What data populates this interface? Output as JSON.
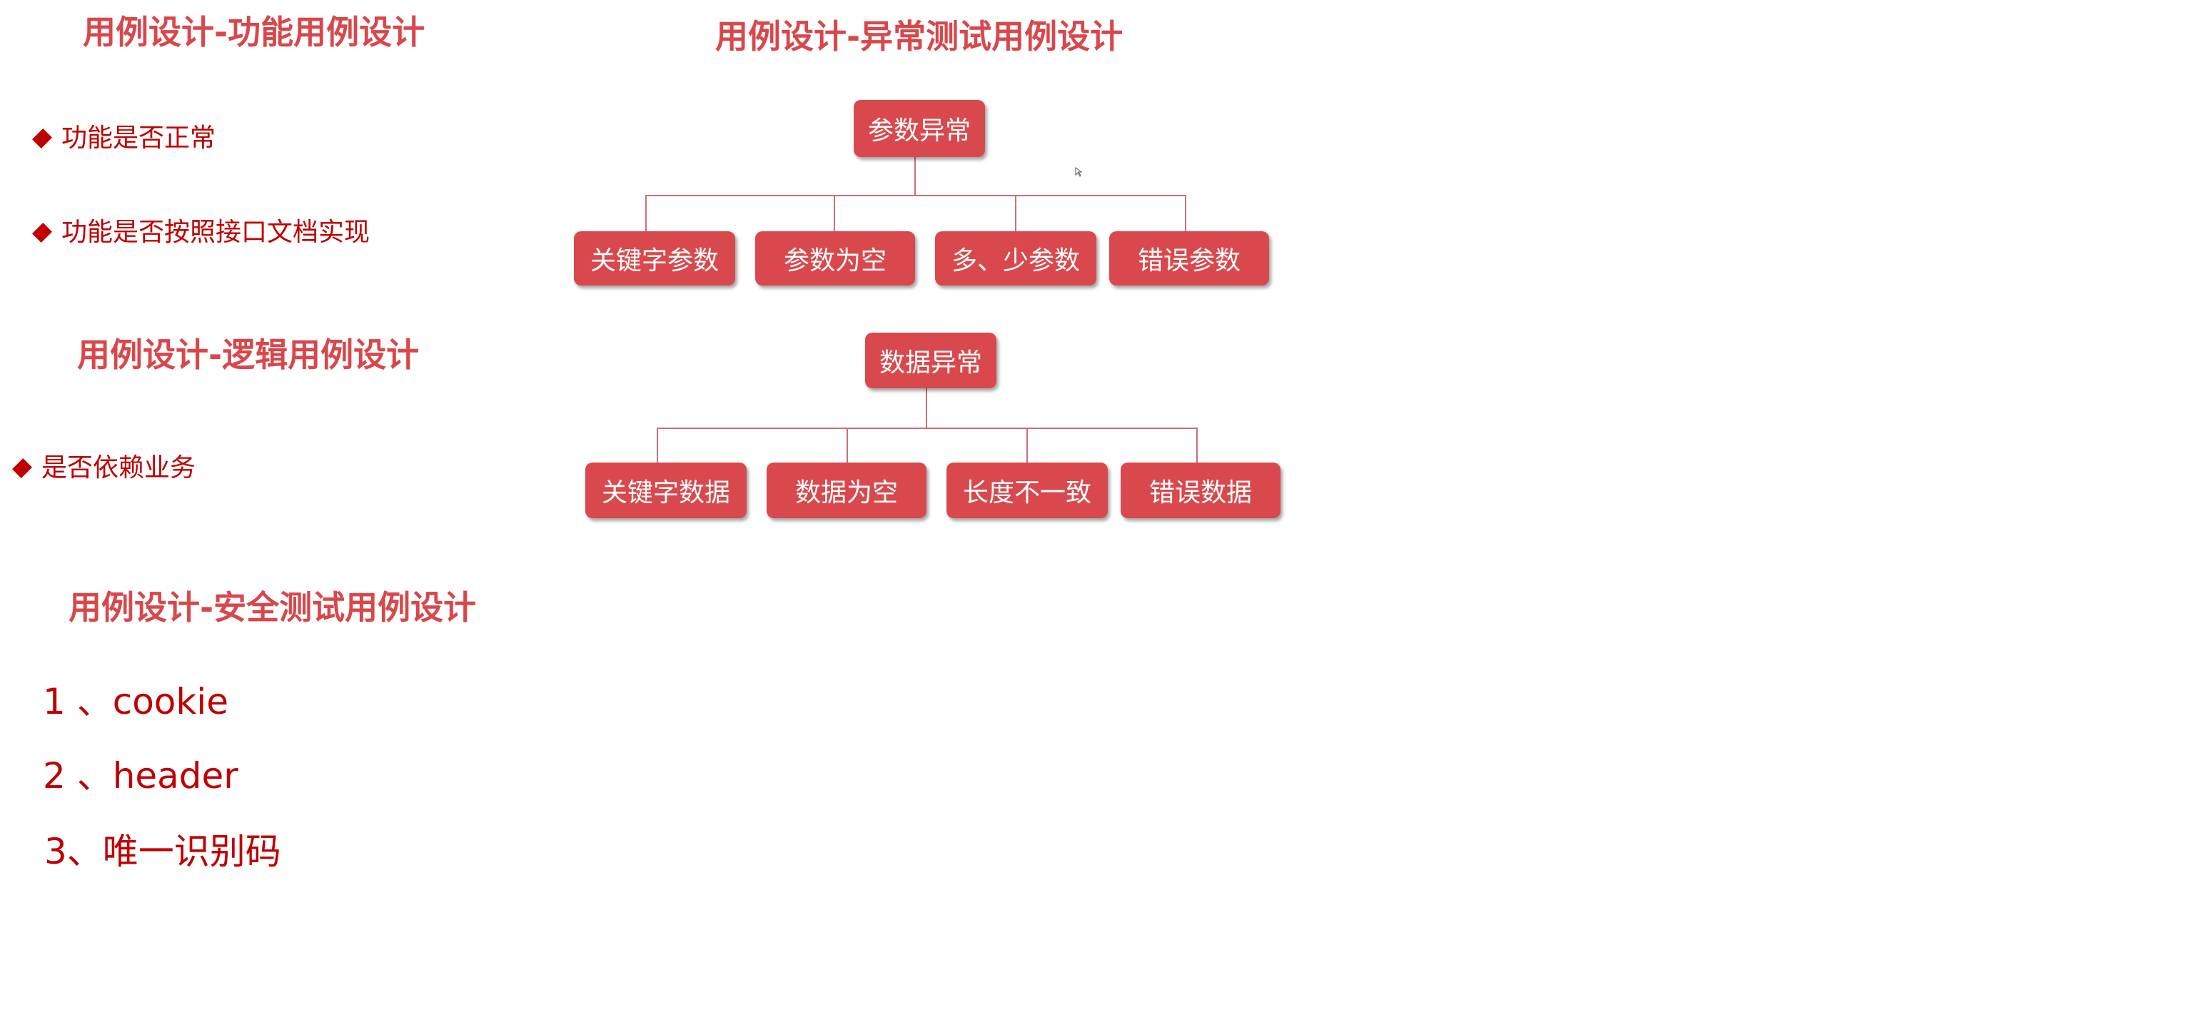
{
  "sections": {
    "functional": {
      "title": "用例设计-功能用例设计",
      "bullets": [
        "功能是否正常",
        "功能是否按照接口文档实现"
      ]
    },
    "logic": {
      "title": "用例设计-逻辑用例设计",
      "bullets": [
        "是否依赖业务"
      ]
    },
    "security": {
      "title": "用例设计-安全测试用例设计",
      "items": [
        "1 、cookie",
        "2 、header",
        "3、唯一识别码"
      ]
    },
    "exception": {
      "title": "用例设计-异常测试用例设计",
      "trees": [
        {
          "root": "参数异常",
          "children": [
            "关键字参数",
            "参数为空",
            "多、少参数",
            "错误参数"
          ]
        },
        {
          "root": "数据异常",
          "children": [
            "关键字数据",
            "数据为空",
            "长度不一致",
            "错误数据"
          ]
        }
      ]
    }
  },
  "colors": {
    "title": "#d9474b",
    "text": "#c00000",
    "box": "#d9484c"
  }
}
